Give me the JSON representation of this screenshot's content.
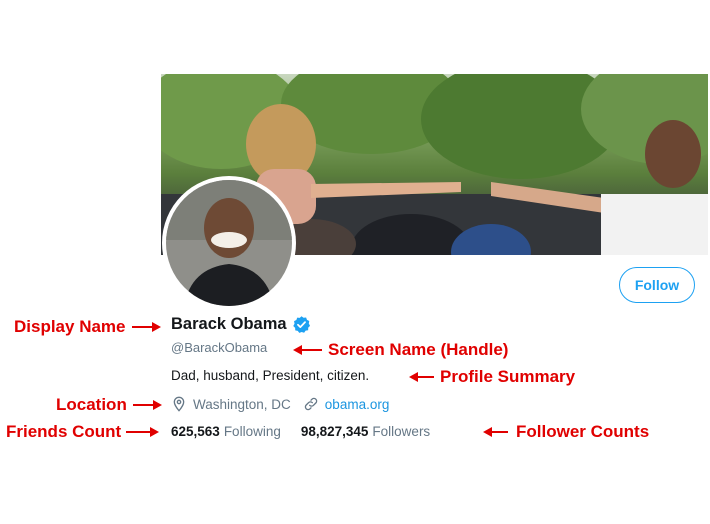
{
  "profile": {
    "display_name": "Barack Obama",
    "handle": "@BarackObama",
    "bio": "Dad, husband, President, citizen.",
    "location": "Washington, DC",
    "website": "obama.org",
    "following_count": "625,563",
    "following_label": "Following",
    "followers_count": "98,827,345",
    "followers_label": "Followers",
    "follow_button": "Follow"
  },
  "annotations": {
    "display_name": "Display Name",
    "screen_name": "Screen Name (Handle)",
    "profile_summary": "Profile Summary",
    "location": "Location",
    "friends_count": "Friends Count",
    "follower_counts": "Follower Counts"
  },
  "icons": {
    "verified": "verified-badge-icon",
    "location": "location-pin-icon",
    "link": "link-icon",
    "arrow": "arrow-icon"
  },
  "colors": {
    "accent": "#1da1f2",
    "link": "#1b95e0",
    "annotation": "#e00000",
    "muted_text": "#657786",
    "primary_text": "#14171a"
  }
}
